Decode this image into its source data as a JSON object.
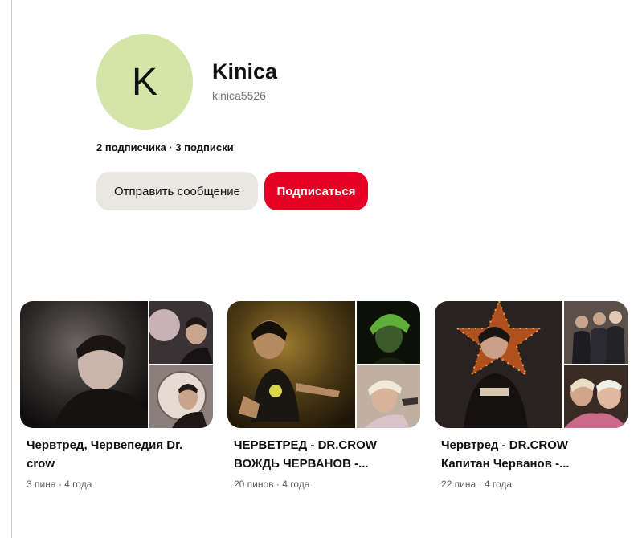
{
  "profile": {
    "avatar_letter": "K",
    "avatar_color": "#d3e5a8",
    "name": "Kinica",
    "handle": "kinica5526",
    "followers_line": "2 подписчика · 3 подписки"
  },
  "actions": {
    "message_label": "Отправить сообщение",
    "follow_label": "Подписаться",
    "follow_color": "#e60023"
  },
  "boards": [
    {
      "title": "Червтред, Червепедия Dr. crow",
      "meta": "3 пина · 4 года"
    },
    {
      "title": "ЧЕРВЕТРЕД - DR.CROW ВОЖДЬ ЧЕРВАНОВ -...",
      "meta": "20 пинов · 4 года"
    },
    {
      "title": "Червтред - DR.CROW Капитан Червaнов -...",
      "meta": "22 пина · 4 года"
    }
  ]
}
